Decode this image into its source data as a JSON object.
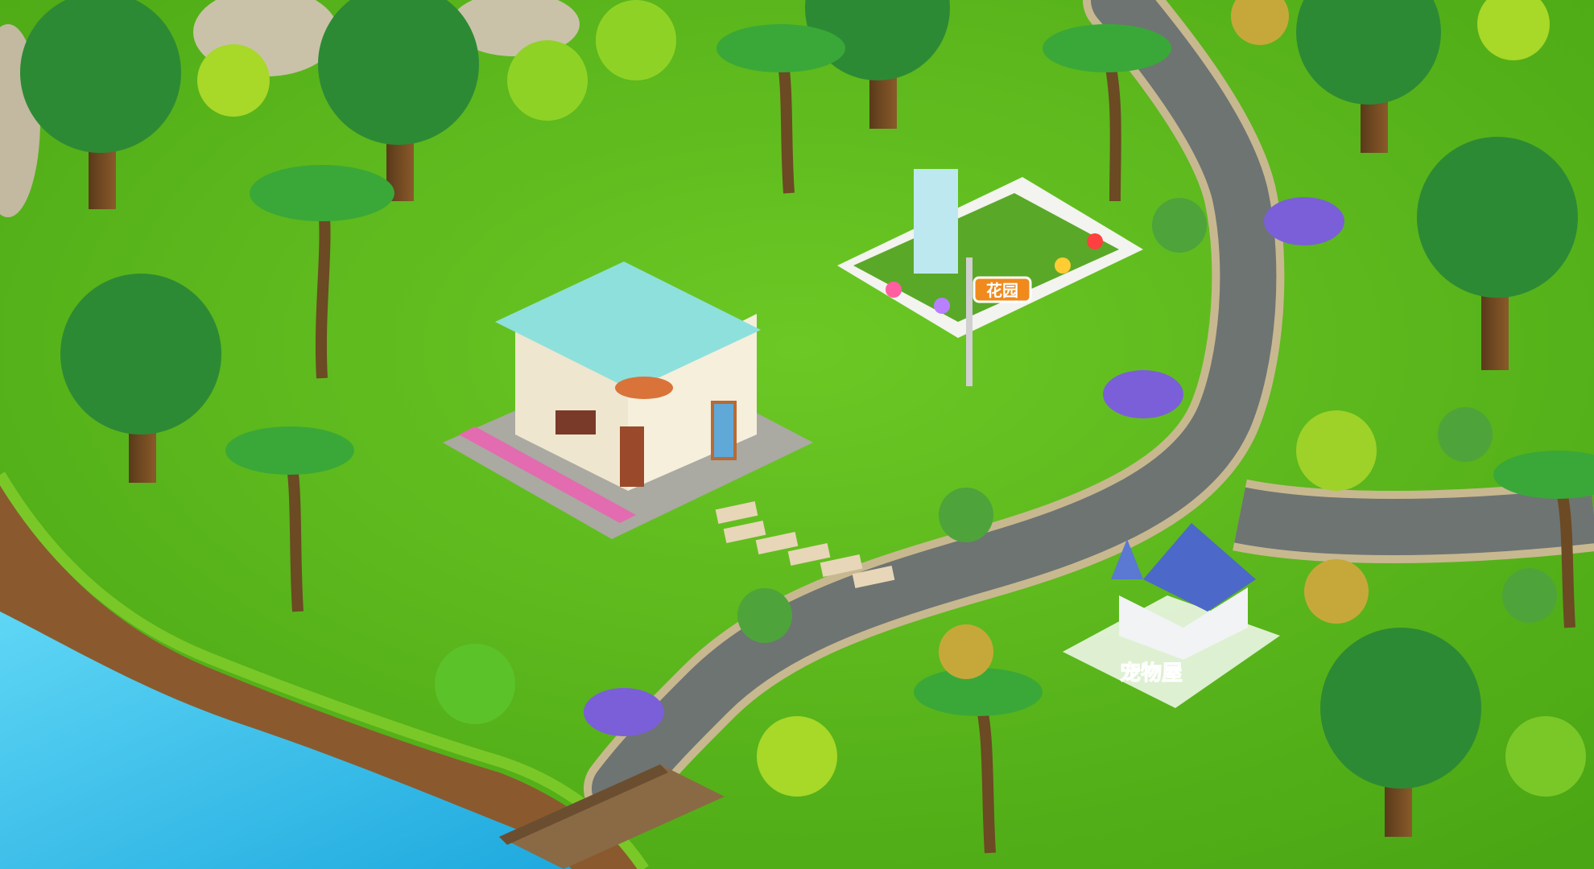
{
  "signs": {
    "garden": "花园",
    "pet_house": "宠物屋"
  },
  "colors": {
    "grass": "#58b81a",
    "grass_light": "#7ed321",
    "road": "#6e7472",
    "road_curb": "#c8b890",
    "water": "#36c3ee",
    "roof_teal": "#8ee0dc",
    "roof_blue": "#4c68c8",
    "sign_orange": "#f08a1c",
    "sign_pink": "#ff4fa8"
  }
}
